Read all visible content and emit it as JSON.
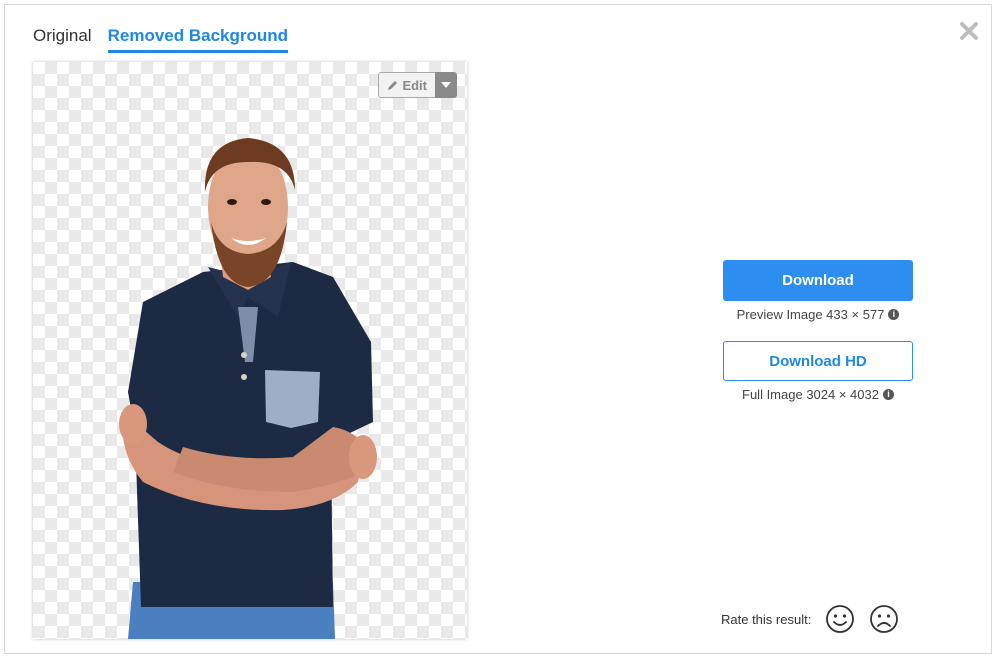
{
  "tabs": [
    {
      "label": "Original",
      "active": false
    },
    {
      "label": "Removed Background",
      "active": true
    }
  ],
  "preview": {
    "edit_label": "Edit"
  },
  "download": {
    "label": "Download",
    "info": "Preview Image 433 × 577"
  },
  "download_hd": {
    "label": "Download HD",
    "info": "Full Image 3024 × 4032"
  },
  "rating": {
    "label": "Rate this result:"
  },
  "colors": {
    "accent": "#1e88e5",
    "button": "#2b8ef0"
  },
  "icons": [
    "close-icon",
    "pencil-icon",
    "caret-down-icon",
    "info-icon",
    "smile-icon",
    "frown-icon"
  ]
}
